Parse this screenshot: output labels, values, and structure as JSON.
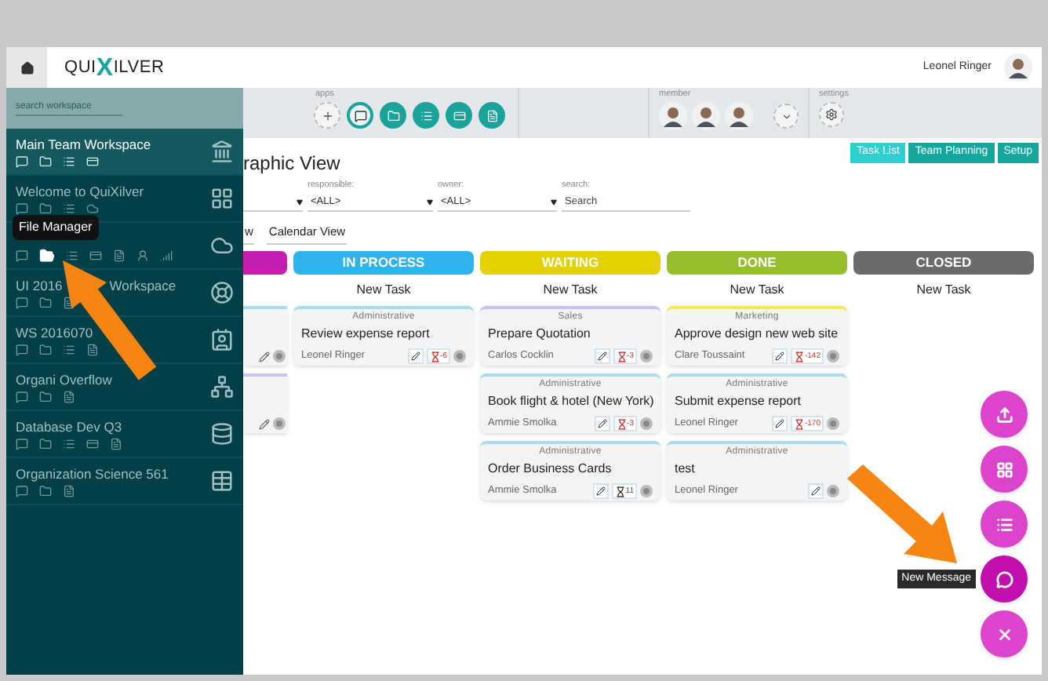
{
  "header": {
    "logo_prefix": "QUI",
    "logo_mark": "X",
    "logo_suffix": "ILVER",
    "user": "Leonel Ringer"
  },
  "sidebar": {
    "search": {
      "placeholder": "search workspace"
    },
    "items": [
      {
        "name": "Main Team Workspace",
        "selected": true,
        "kind": "bank",
        "icons": [
          {
            "kind": "chat",
            "hovered": false
          },
          {
            "kind": "folder",
            "hovered": false
          },
          {
            "kind": "list",
            "hovered": false
          },
          {
            "kind": "card",
            "hovered": false
          }
        ]
      },
      {
        "name": "Welcome to QuiXilver",
        "selected": false,
        "kind": "grid",
        "icons": [
          {
            "kind": "chat",
            "hovered": false
          },
          {
            "kind": "folder",
            "hovered": false
          },
          {
            "kind": "list",
            "hovered": false
          },
          {
            "kind": "cloud",
            "hovered": false
          }
        ]
      },
      {
        "selected": false,
        "kind": "cloud",
        "icons": [
          {
            "kind": "chat",
            "hovered": false
          },
          {
            "kind": "folder",
            "hovered": true
          },
          {
            "kind": "list",
            "hovered": false
          },
          {
            "kind": "card",
            "hovered": false
          },
          {
            "kind": "note",
            "hovered": false
          },
          {
            "kind": "person",
            "hovered": false
          },
          {
            "kind": "chart",
            "hovered": false
          }
        ]
      },
      {
        "name": "UI 2016",
        "name_tail": "Workspace",
        "selected": false,
        "kind": "lifebuoy",
        "icons": [
          {
            "kind": "chat",
            "hovered": false
          },
          {
            "kind": "folder",
            "hovered": false
          },
          {
            "kind": "note",
            "hovered": false
          }
        ]
      },
      {
        "name": "WS 2016070",
        "selected": false,
        "kind": "idcard",
        "icons": [
          {
            "kind": "chat",
            "hovered": false
          },
          {
            "kind": "folder",
            "hovered": false
          },
          {
            "kind": "list",
            "hovered": false
          },
          {
            "kind": "note",
            "hovered": false
          }
        ]
      },
      {
        "name": "Organi Overflow",
        "selected": false,
        "kind": "sitemap",
        "icons": [
          {
            "kind": "chat",
            "hovered": false
          },
          {
            "kind": "folder",
            "hovered": false
          },
          {
            "kind": "note",
            "hovered": false
          }
        ]
      },
      {
        "name": "Database Dev Q3",
        "selected": false,
        "kind": "database",
        "icons": [
          {
            "kind": "chat",
            "hovered": false
          },
          {
            "kind": "folder",
            "hovered": false
          },
          {
            "kind": "list",
            "hovered": false
          },
          {
            "kind": "card",
            "hovered": false
          },
          {
            "kind": "note",
            "hovered": false
          }
        ]
      },
      {
        "name": "Organization Science 561",
        "selected": false,
        "kind": "table",
        "icons": [
          {
            "kind": "chat",
            "hovered": false
          },
          {
            "kind": "folder",
            "hovered": false
          },
          {
            "kind": "note",
            "hovered": false
          }
        ]
      }
    ],
    "tooltip": "File Manager"
  },
  "toolbar": {
    "apps_label": "apps",
    "apps": [
      {
        "kind": "add",
        "selected": false
      },
      {
        "kind": "chat",
        "selected": true
      },
      {
        "kind": "folder",
        "selected": false
      },
      {
        "kind": "list",
        "selected": false
      },
      {
        "kind": "card",
        "selected": false
      },
      {
        "kind": "note",
        "selected": false
      }
    ],
    "members_label": "member",
    "members": [
      {
        "kind": "avatar"
      },
      {
        "kind": "avatar"
      },
      {
        "kind": "avatar"
      },
      {
        "kind": "more"
      }
    ],
    "settings_label": "settings"
  },
  "view": {
    "title": "raphic View",
    "buttons": [
      {
        "label": "Task List",
        "selected": true
      },
      {
        "label": "Team Planning",
        "selected": false
      },
      {
        "label": "Setup",
        "selected": false
      }
    ],
    "filters": [
      {
        "kind": "select"
      },
      {
        "kind": "select",
        "label": "responsible:",
        "value": "<ALL>"
      },
      {
        "kind": "select",
        "label": "owner:",
        "value": "<ALL>"
      },
      {
        "kind": "search",
        "label": "search:",
        "placeholder": "Search"
      }
    ],
    "tabs": [
      "w",
      "Calendar View"
    ]
  },
  "board": {
    "columns": [
      {
        "kind": "partial",
        "color": "#c21fae",
        "cards": [
          {
            "color": "#a9dcec"
          },
          {
            "color": "#c8c3f0"
          }
        ]
      },
      {
        "kind": "full",
        "label": "IN PROCESS",
        "color": "#2fb3ec",
        "new_task": "New Task",
        "cards": [
          {
            "color": "#a9dcec",
            "category": "Administrative",
            "title": "Review expense report",
            "person": "Leonel Ringer",
            "days": "-6",
            "overdue": true
          }
        ]
      },
      {
        "kind": "full",
        "label": "WAITING",
        "color": "#e3d200",
        "new_task": "New Task",
        "cards": [
          {
            "color": "#c8c3f0",
            "category": "Sales",
            "title": "Prepare Quotation",
            "person": "Carlos Cocklin",
            "days": "-3",
            "overdue": true
          },
          {
            "color": "#a9dcec",
            "category": "Administrative",
            "title": "Book flight & hotel (New York)",
            "person": "Ammie Smolka",
            "days": "-3",
            "overdue": true
          },
          {
            "color": "#a9dcec",
            "category": "Administrative",
            "title": "Order Business Cards",
            "person": "Ammie Smolka",
            "days": "11",
            "overdue": false
          }
        ]
      },
      {
        "kind": "full",
        "label": "DONE",
        "color": "#97be2d",
        "new_task": "New Task",
        "cards": [
          {
            "color": "#f2ea4e",
            "category": "Marketing",
            "title": "Approve design new web site",
            "person": "Clare Toussaint",
            "days": "-142",
            "overdue": true
          },
          {
            "color": "#a9dcec",
            "category": "Administrative",
            "title": "Submit expense report",
            "person": "Leonel Ringer",
            "days": "-170",
            "overdue": true
          },
          {
            "color": "#a9dcec",
            "category": "Administrative",
            "title": "test",
            "person": "Leonel Ringer"
          }
        ]
      },
      {
        "kind": "full",
        "label": "CLOSED",
        "color": "#6b6b6b",
        "new_task": "New Task"
      }
    ]
  },
  "fabs": [
    {
      "kind": "upload",
      "hovered": false
    },
    {
      "kind": "grid",
      "hovered": false
    },
    {
      "kind": "list",
      "hovered": false
    },
    {
      "kind": "message",
      "hovered": true
    },
    {
      "kind": "close",
      "hovered": false
    }
  ],
  "fab_tooltip": "New Message"
}
